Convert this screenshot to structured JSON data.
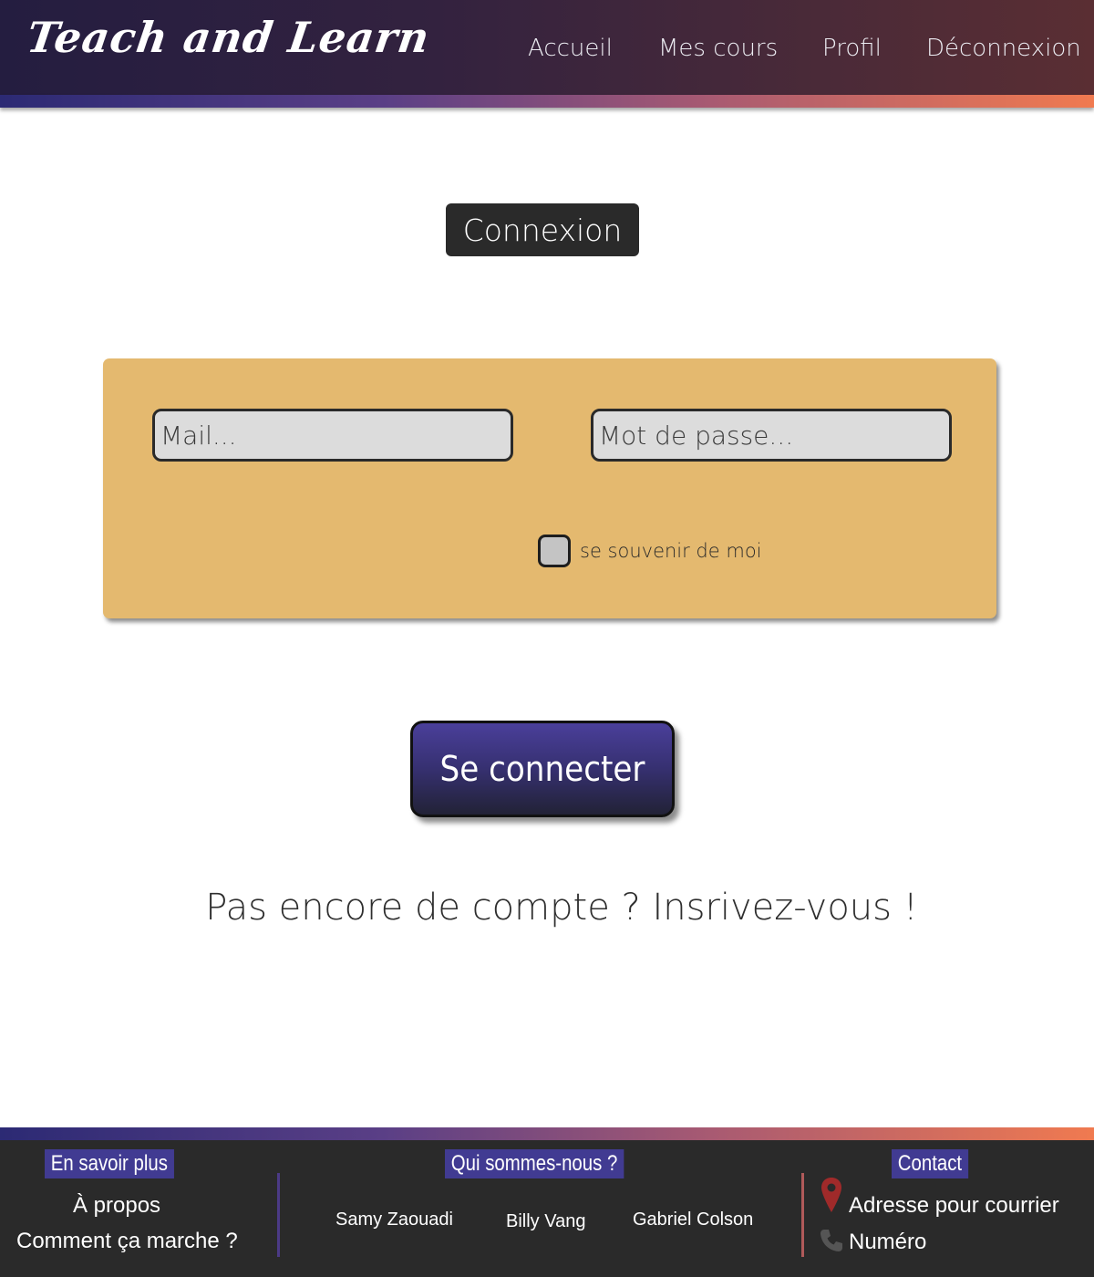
{
  "header": {
    "logo": "Teach  and Learn",
    "nav": [
      "Accueil",
      "Mes cours",
      "Profil",
      "Déconnexion"
    ]
  },
  "main": {
    "title": "Connexion",
    "mail_placeholder": "Mail...",
    "password_placeholder": "Mot de passe...",
    "remember_label": "se souvenir de moi",
    "submit_label": "Se connecter",
    "signup_text": "Pas encore de compte ? Insrivez-vous !"
  },
  "footer": {
    "about": {
      "title": "En savoir plus",
      "links": [
        "À propos",
        "Comment ça marche ?"
      ]
    },
    "team": {
      "title": "Qui sommes-nous ?",
      "members": [
        "Samy Zaouadi",
        "Billy Vang",
        "Gabriel Colson"
      ]
    },
    "contact": {
      "title": "Contact",
      "address_label": "Adresse pour courrier",
      "phone_label": "Numéro"
    }
  },
  "colors": {
    "header_bg": "#2b1f3e",
    "accent_gradient": [
      "#2c2a74",
      "#f07a50"
    ],
    "panel": "#e4b96f",
    "button": "#3a3278",
    "footer_bg": "#2a2a2a",
    "footer_title_bg": "#413b92"
  },
  "icons": [
    "map-pin-icon",
    "phone-icon"
  ]
}
